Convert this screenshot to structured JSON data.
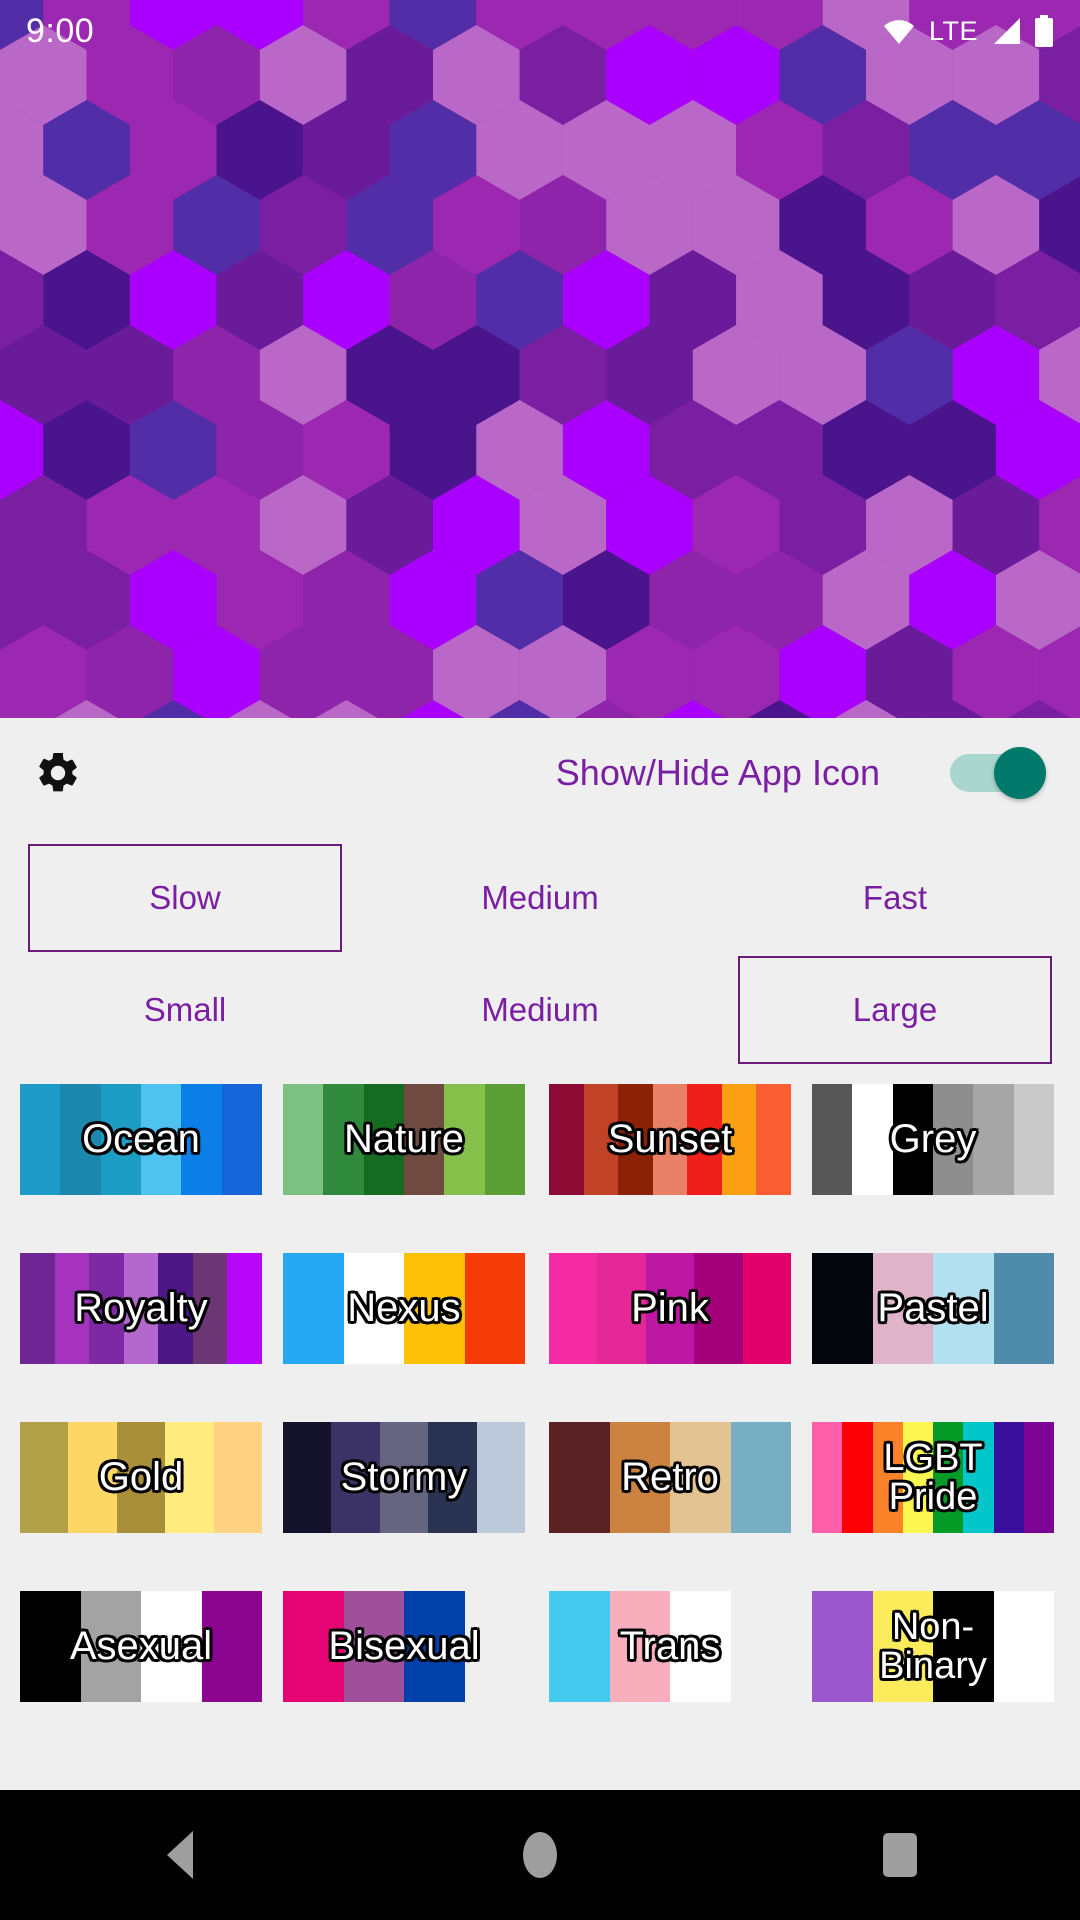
{
  "status_bar": {
    "time": "9:00",
    "network_label": "LTE",
    "icons": [
      "wifi-icon",
      "signal-icon",
      "battery-icon"
    ]
  },
  "wallpaper": {
    "name": "hexagon-wallpaper",
    "palette_name": "Royalty",
    "colors": [
      "#aa00ff",
      "#9c27b0",
      "#7b1fa2",
      "#4a148c",
      "#ba68c8",
      "#6a1b9a",
      "#8e24aa",
      "#512da8"
    ]
  },
  "toolbar": {
    "settings_icon": "gear-icon",
    "toggle_label": "Show/Hide App Icon",
    "toggle_on": true,
    "toggle_track_color": "#a9d6ce",
    "toggle_thumb_color": "#00796B",
    "accent_color": "#7B1FA2"
  },
  "speed_options": [
    {
      "label": "Slow",
      "selected": true
    },
    {
      "label": "Medium",
      "selected": false
    },
    {
      "label": "Fast",
      "selected": false
    }
  ],
  "size_options": [
    {
      "label": "Small",
      "selected": false
    },
    {
      "label": "Medium",
      "selected": false
    },
    {
      "label": "Large",
      "selected": true
    }
  ],
  "palettes": [
    {
      "name": "Ocean",
      "colors": [
        "#1f9bc9",
        "#1c88ad",
        "#1e9dc4",
        "#4fc3ef",
        "#0b7ee8",
        "#1565d8"
      ]
    },
    {
      "name": "Nature",
      "colors": [
        "#7cc181",
        "#2f8a3d",
        "#156b22",
        "#6e4a41",
        "#84c04a",
        "#5b9e36"
      ]
    },
    {
      "name": "Sunset",
      "colors": [
        "#8c0b34",
        "#c04227",
        "#8c2205",
        "#e87f67",
        "#ef2019",
        "#fba015",
        "#f95d32"
      ]
    },
    {
      "name": "Grey",
      "colors": [
        "#565656",
        "#ffffff",
        "#000000",
        "#8e8e8e",
        "#a6a6a6",
        "#c9c9c9"
      ]
    },
    {
      "name": "Royalty",
      "colors": [
        "#6f2594",
        "#a434bd",
        "#7c29a3",
        "#b468cd",
        "#4d1785",
        "#6c3574",
        "#b806fb"
      ]
    },
    {
      "name": "Nexus",
      "colors": [
        "#27a8f3",
        "#ffffff",
        "#ffc107",
        "#f53b06"
      ]
    },
    {
      "name": "Pink",
      "colors": [
        "#f52ba3",
        "#e52897",
        "#bd17a3",
        "#a4007b",
        "#e2006b"
      ]
    },
    {
      "name": "Pastel",
      "colors": [
        "#04060e",
        "#dfb4c8",
        "#b2e0f0",
        "#4f8bab"
      ]
    },
    {
      "name": "Gold",
      "colors": [
        "#b3a14a",
        "#fcd766",
        "#a98f37",
        "#ffeb7e",
        "#ffd382"
      ]
    },
    {
      "name": "Stormy",
      "colors": [
        "#15122b",
        "#3b3366",
        "#666580",
        "#2b3353",
        "#bbc9db"
      ]
    },
    {
      "name": "Retro",
      "colors": [
        "#5b2226",
        "#cc8341",
        "#e2c391",
        "#77aec4"
      ]
    },
    {
      "name": "LGBT\nPride",
      "colors": [
        "#ff5fa8",
        "#fb0105",
        "#fc8229",
        "#fbf751",
        "#049b26",
        "#02c7ca",
        "#3b0f9e",
        "#7d0495"
      ]
    },
    {
      "name": "Asexual",
      "colors": [
        "#000000",
        "#a3a3a3",
        "#ffffff",
        "#8b058e"
      ]
    },
    {
      "name": "Bisexual",
      "colors": [
        "#e40572",
        "#a0509b",
        "#0040ab"
      ]
    },
    {
      "name": "Trans",
      "colors": [
        "#44caee",
        "#f8aebc",
        "#ffffff"
      ]
    },
    {
      "name": "Non-\nBinary",
      "colors": [
        "#9a56cc",
        "#fcec5c",
        "#000000",
        "#ffffff"
      ]
    }
  ],
  "nav_bar": {
    "back_label": "back-button",
    "home_label": "home-button",
    "recents_label": "recents-button",
    "icon_color": "#9e9e9e"
  }
}
